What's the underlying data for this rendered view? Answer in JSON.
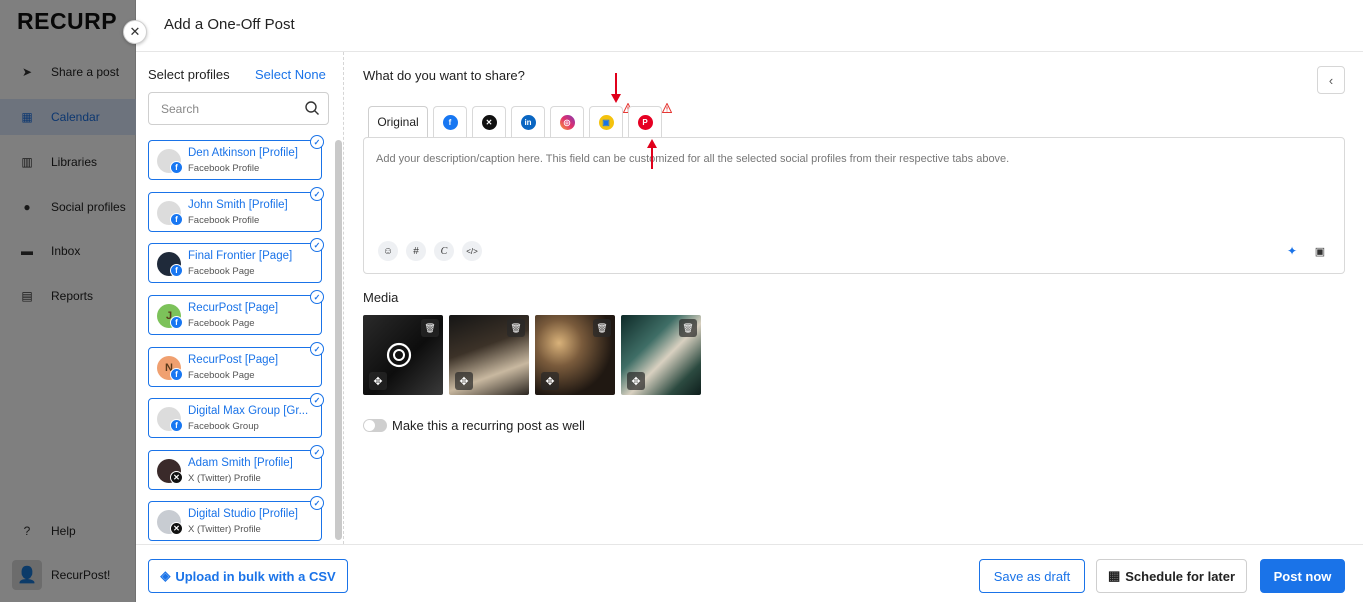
{
  "app": {
    "logo": "RECURP",
    "nav": [
      {
        "label": "Share a post",
        "icon": "send-icon"
      },
      {
        "label": "Calendar",
        "icon": "calendar-icon",
        "active": true
      },
      {
        "label": "Libraries",
        "icon": "library-icon"
      },
      {
        "label": "Social profiles",
        "icon": "user-circle-icon"
      },
      {
        "label": "Inbox",
        "icon": "inbox-icon"
      },
      {
        "label": "Reports",
        "icon": "reports-icon"
      }
    ],
    "help": "Help",
    "user": "RecurPost!"
  },
  "modal": {
    "title": "Add a One-Off Post",
    "close_icon": "close-icon"
  },
  "profiles": {
    "heading": "Select profiles",
    "select_none": "Select None",
    "search_placeholder": "Search",
    "items": [
      {
        "name": "Den Atkinson [Profile]",
        "type": "Facebook Profile",
        "network": "facebook",
        "avatar_color": "#dcdcdc"
      },
      {
        "name": "John Smith [Profile]",
        "type": "Facebook Profile",
        "network": "facebook",
        "avatar_color": "#dcdcdc"
      },
      {
        "name": "Final Frontier [Page]",
        "type": "Facebook Page",
        "network": "facebook",
        "avatar_color": "#1f2a3a"
      },
      {
        "name": "RecurPost [Page]",
        "type": "Facebook Page",
        "network": "facebook",
        "avatar_color": "#7cc25a",
        "initial": "J"
      },
      {
        "name": "RecurPost [Page]",
        "type": "Facebook Page",
        "network": "facebook",
        "avatar_color": "#f0a070",
        "initial": "N"
      },
      {
        "name": "Digital Max Group [Gr...",
        "type": "Facebook Group",
        "network": "facebook",
        "avatar_color": "#dcdcdc"
      },
      {
        "name": "Adam Smith [Profile]",
        "type": "X (Twitter) Profile",
        "network": "x",
        "avatar_color": "#3a2a2a"
      },
      {
        "name": "Digital Studio [Profile]",
        "type": "X (Twitter) Profile",
        "network": "x",
        "avatar_color": "#c8ccd2"
      }
    ]
  },
  "editor": {
    "question": "What do you want to share?",
    "tabs": [
      {
        "label": "Original"
      },
      {
        "icon": "facebook-icon",
        "color": "#1877f2",
        "glyph": "f"
      },
      {
        "icon": "x-icon",
        "color": "#111111",
        "glyph": "𝕏"
      },
      {
        "icon": "linkedin-icon",
        "color": "#0a66c2",
        "glyph": "in"
      },
      {
        "icon": "instagram-icon",
        "color": "#e1306c",
        "glyph": "◎"
      },
      {
        "icon": "google-business-icon",
        "color": "#f4c20d",
        "glyph": "▣",
        "warning": true
      },
      {
        "icon": "pinterest-icon",
        "color": "#e60023",
        "glyph": "P",
        "warning": true
      }
    ],
    "placeholder": "Add your description/caption here. This field can be customized for all the selected social profiles from their respective tabs above.",
    "tools": [
      "☺",
      "#",
      "C",
      "</>"
    ],
    "media_label": "Media",
    "recurring_label": "Make this a recurring post as well"
  },
  "footer": {
    "upload_csv": "Upload in bulk with a CSV",
    "save_draft": "Save as draft",
    "schedule": "Schedule for later",
    "post_now": "Post now"
  }
}
